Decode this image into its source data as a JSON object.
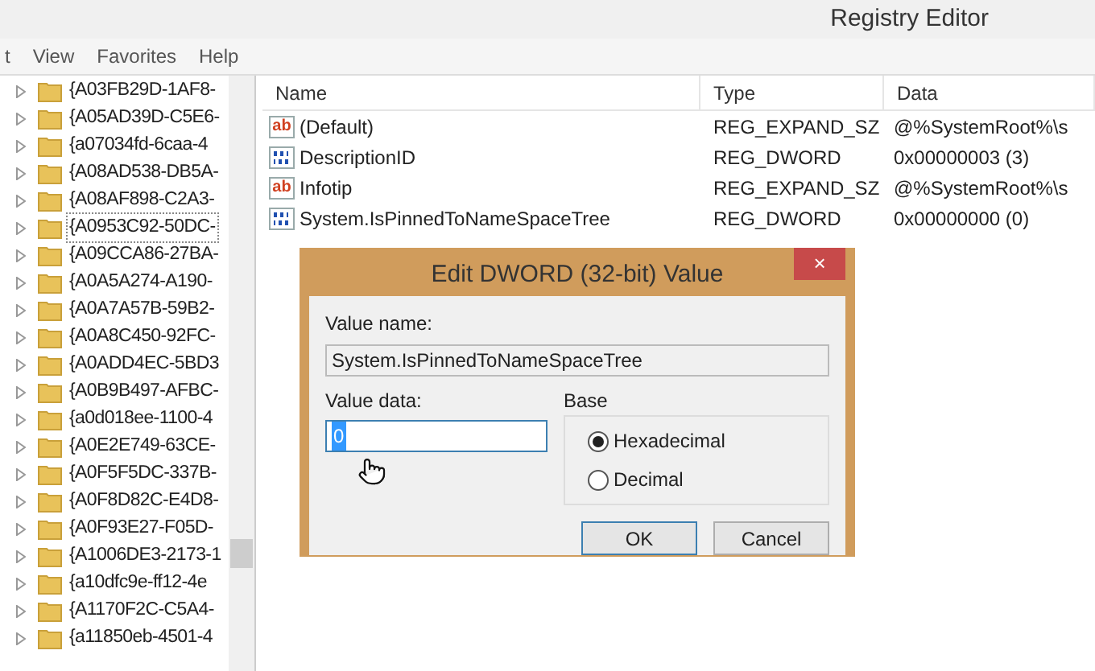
{
  "window": {
    "title": "Registry Editor"
  },
  "menu": [
    "t",
    "View",
    "Favorites",
    "Help"
  ],
  "tree": [
    {
      "label": "{A03FB29D-1AF8-",
      "focused": false
    },
    {
      "label": "{A05AD39D-C5E6-",
      "focused": false
    },
    {
      "label": "{a07034fd-6caa-4",
      "focused": false
    },
    {
      "label": "{A08AD538-DB5A-",
      "focused": false
    },
    {
      "label": "{A08AF898-C2A3-",
      "focused": false
    },
    {
      "label": "{A0953C92-50DC-",
      "focused": true
    },
    {
      "label": "{A09CCA86-27BA-",
      "focused": false
    },
    {
      "label": "{A0A5A274-A190-",
      "focused": false
    },
    {
      "label": "{A0A7A57B-59B2-",
      "focused": false
    },
    {
      "label": "{A0A8C450-92FC-",
      "focused": false
    },
    {
      "label": "{A0ADD4EC-5BD3",
      "focused": false
    },
    {
      "label": "{A0B9B497-AFBC-",
      "focused": false
    },
    {
      "label": "{a0d018ee-1100-4",
      "focused": false
    },
    {
      "label": "{A0E2E749-63CE-",
      "focused": false
    },
    {
      "label": "{A0F5F5DC-337B-",
      "focused": false
    },
    {
      "label": "{A0F8D82C-E4D8-",
      "focused": false
    },
    {
      "label": "{A0F93E27-F05D-",
      "focused": false
    },
    {
      "label": "{A1006DE3-2173-1",
      "focused": false
    },
    {
      "label": "{a10dfc9e-ff12-4e",
      "focused": false
    },
    {
      "label": "{A1170F2C-C5A4-",
      "focused": false
    },
    {
      "label": "{a11850eb-4501-4",
      "focused": false
    }
  ],
  "table": {
    "columns": [
      "Name",
      "Type",
      "Data"
    ],
    "rows": [
      {
        "kind": "string",
        "icon": "ab",
        "name": "(Default)",
        "type": "REG_EXPAND_SZ",
        "data": "@%SystemRoot%\\s"
      },
      {
        "kind": "binary",
        "name": "DescriptionID",
        "type": "REG_DWORD",
        "data": "0x00000003 (3)"
      },
      {
        "kind": "string",
        "icon": "ab",
        "name": "Infotip",
        "type": "REG_EXPAND_SZ",
        "data": "@%SystemRoot%\\s"
      },
      {
        "kind": "binary",
        "name": "System.IsPinnedToNameSpaceTree",
        "type": "REG_DWORD",
        "data": "0x00000000 (0)"
      }
    ]
  },
  "dialog": {
    "title": "Edit DWORD (32-bit) Value",
    "close": "×",
    "value_name_label": "Value name:",
    "value_name": "System.IsPinnedToNameSpaceTree",
    "value_data_label": "Value data:",
    "value_data": "0",
    "base_label": "Base",
    "bases": [
      {
        "label": "Hexadecimal",
        "selected": true
      },
      {
        "label": "Decimal",
        "selected": false
      }
    ],
    "buttons": [
      {
        "label": "OK",
        "default": true
      },
      {
        "label": "Cancel",
        "default": false
      }
    ]
  }
}
